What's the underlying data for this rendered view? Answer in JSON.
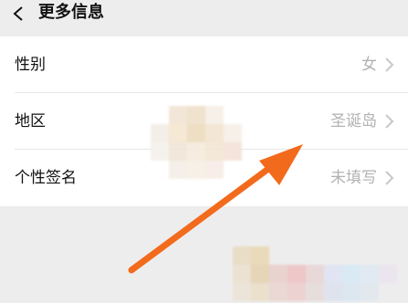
{
  "header": {
    "title": "更多信息",
    "back_icon": "chevron-left-icon"
  },
  "rows": [
    {
      "label": "性别",
      "value": "女"
    },
    {
      "label": "地区",
      "value": "圣诞岛"
    },
    {
      "label": "个性签名",
      "value": "未填写"
    }
  ],
  "colors": {
    "background": "#ededed",
    "card": "#ffffff",
    "label_text": "#111111",
    "value_text": "#b2b2b2",
    "arrow": "#f26b1d"
  },
  "annotation": {
    "icon": "arrow-annotation-icon"
  }
}
